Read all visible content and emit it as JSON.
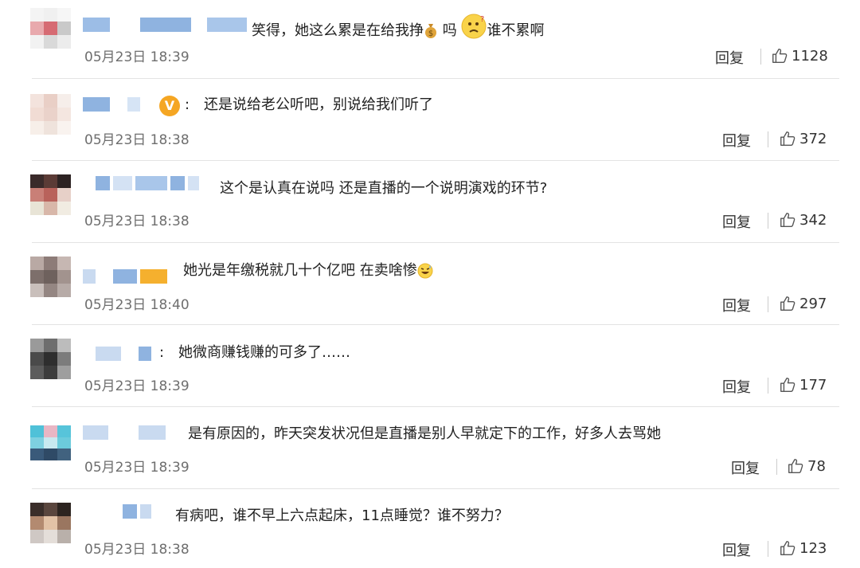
{
  "reply_label": "回复",
  "comments": [
    {
      "text_before": "笑得，她这么累是在给我挣",
      "text_mid": "吗",
      "text_after": "谁不累啊",
      "time": "05月23日 18:39",
      "likes": "1128"
    },
    {
      "text": "还是说给老公听吧，别说给我们听了",
      "colon": ":",
      "time": "05月23日 18:38",
      "likes": "372"
    },
    {
      "text": "这个是认真在说吗 还是直播的一个说明演戏的环节?",
      "time": "05月23日 18:38",
      "likes": "342"
    },
    {
      "text": "她光是年缴税就几十个亿吧 在卖啥惨",
      "time": "05月23日 18:40",
      "likes": "297"
    },
    {
      "text": "她微商赚钱赚的可多了……",
      "colon": ":",
      "time": "05月23日 18:39",
      "likes": "177"
    },
    {
      "text": "是有原因的，昨天突发状况但是直播是别人早就定下的工作，好多人去骂她",
      "time": "05月23日 18:39",
      "likes": "78"
    },
    {
      "text": "有病吧，谁不早上六点起床，11点睡觉？谁不努力？",
      "time": "05月23日 18:38",
      "likes": "123"
    }
  ],
  "icons": {
    "like": "thumbs-up-icon",
    "money": "money-bag-icon",
    "confused": "confused-face-icon",
    "sweat": "sweat-smile-icon",
    "verified": "verified-v-icon"
  },
  "colors": {
    "blur_blue": "#8fb3e0",
    "verified": "#f5a623",
    "divider": "#e3e3e3"
  }
}
